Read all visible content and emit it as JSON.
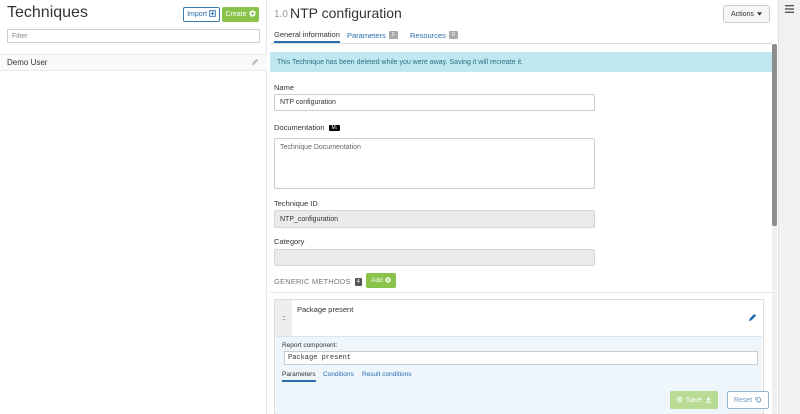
{
  "sidebar": {
    "title": "Techniques",
    "import_label": "Import",
    "create_label": "Create",
    "filter_placeholder": "Filter",
    "items": [
      {
        "label": "Demo User"
      }
    ]
  },
  "header": {
    "version": "1.0",
    "title": "NTP configuration",
    "actions_label": "Actions"
  },
  "tabs": [
    {
      "label": "General information",
      "active": true
    },
    {
      "label": "Parameters",
      "badge": "0"
    },
    {
      "label": "Resources",
      "badge": "0"
    }
  ],
  "alert": "This Technique has been deleted while you were away. Saving it will recreate it.",
  "form": {
    "name_label": "Name",
    "name_value": "NTP configuration",
    "doc_label": "Documentation",
    "doc_badge": "M↓",
    "doc_placeholder": "Technique Documentation",
    "id_label": "Technique ID",
    "id_value": "NTP_configuration",
    "category_label": "Category",
    "category_value": ""
  },
  "generic_methods": {
    "title": "GENERIC METHODS",
    "count": "4",
    "add_label": "Add",
    "methods": [
      {
        "name": "Package present",
        "report_label": "Report component:",
        "report_value": "Package present",
        "subtabs": [
          "Parameters",
          "Conditions",
          "Result conditions"
        ]
      }
    ]
  },
  "footer": {
    "save_label": "Save",
    "reset_label": "Reset"
  },
  "colors": {
    "accent_blue": "#2a6db0",
    "accent_green": "#8ac34a",
    "alert_bg": "#bfe8f0"
  }
}
